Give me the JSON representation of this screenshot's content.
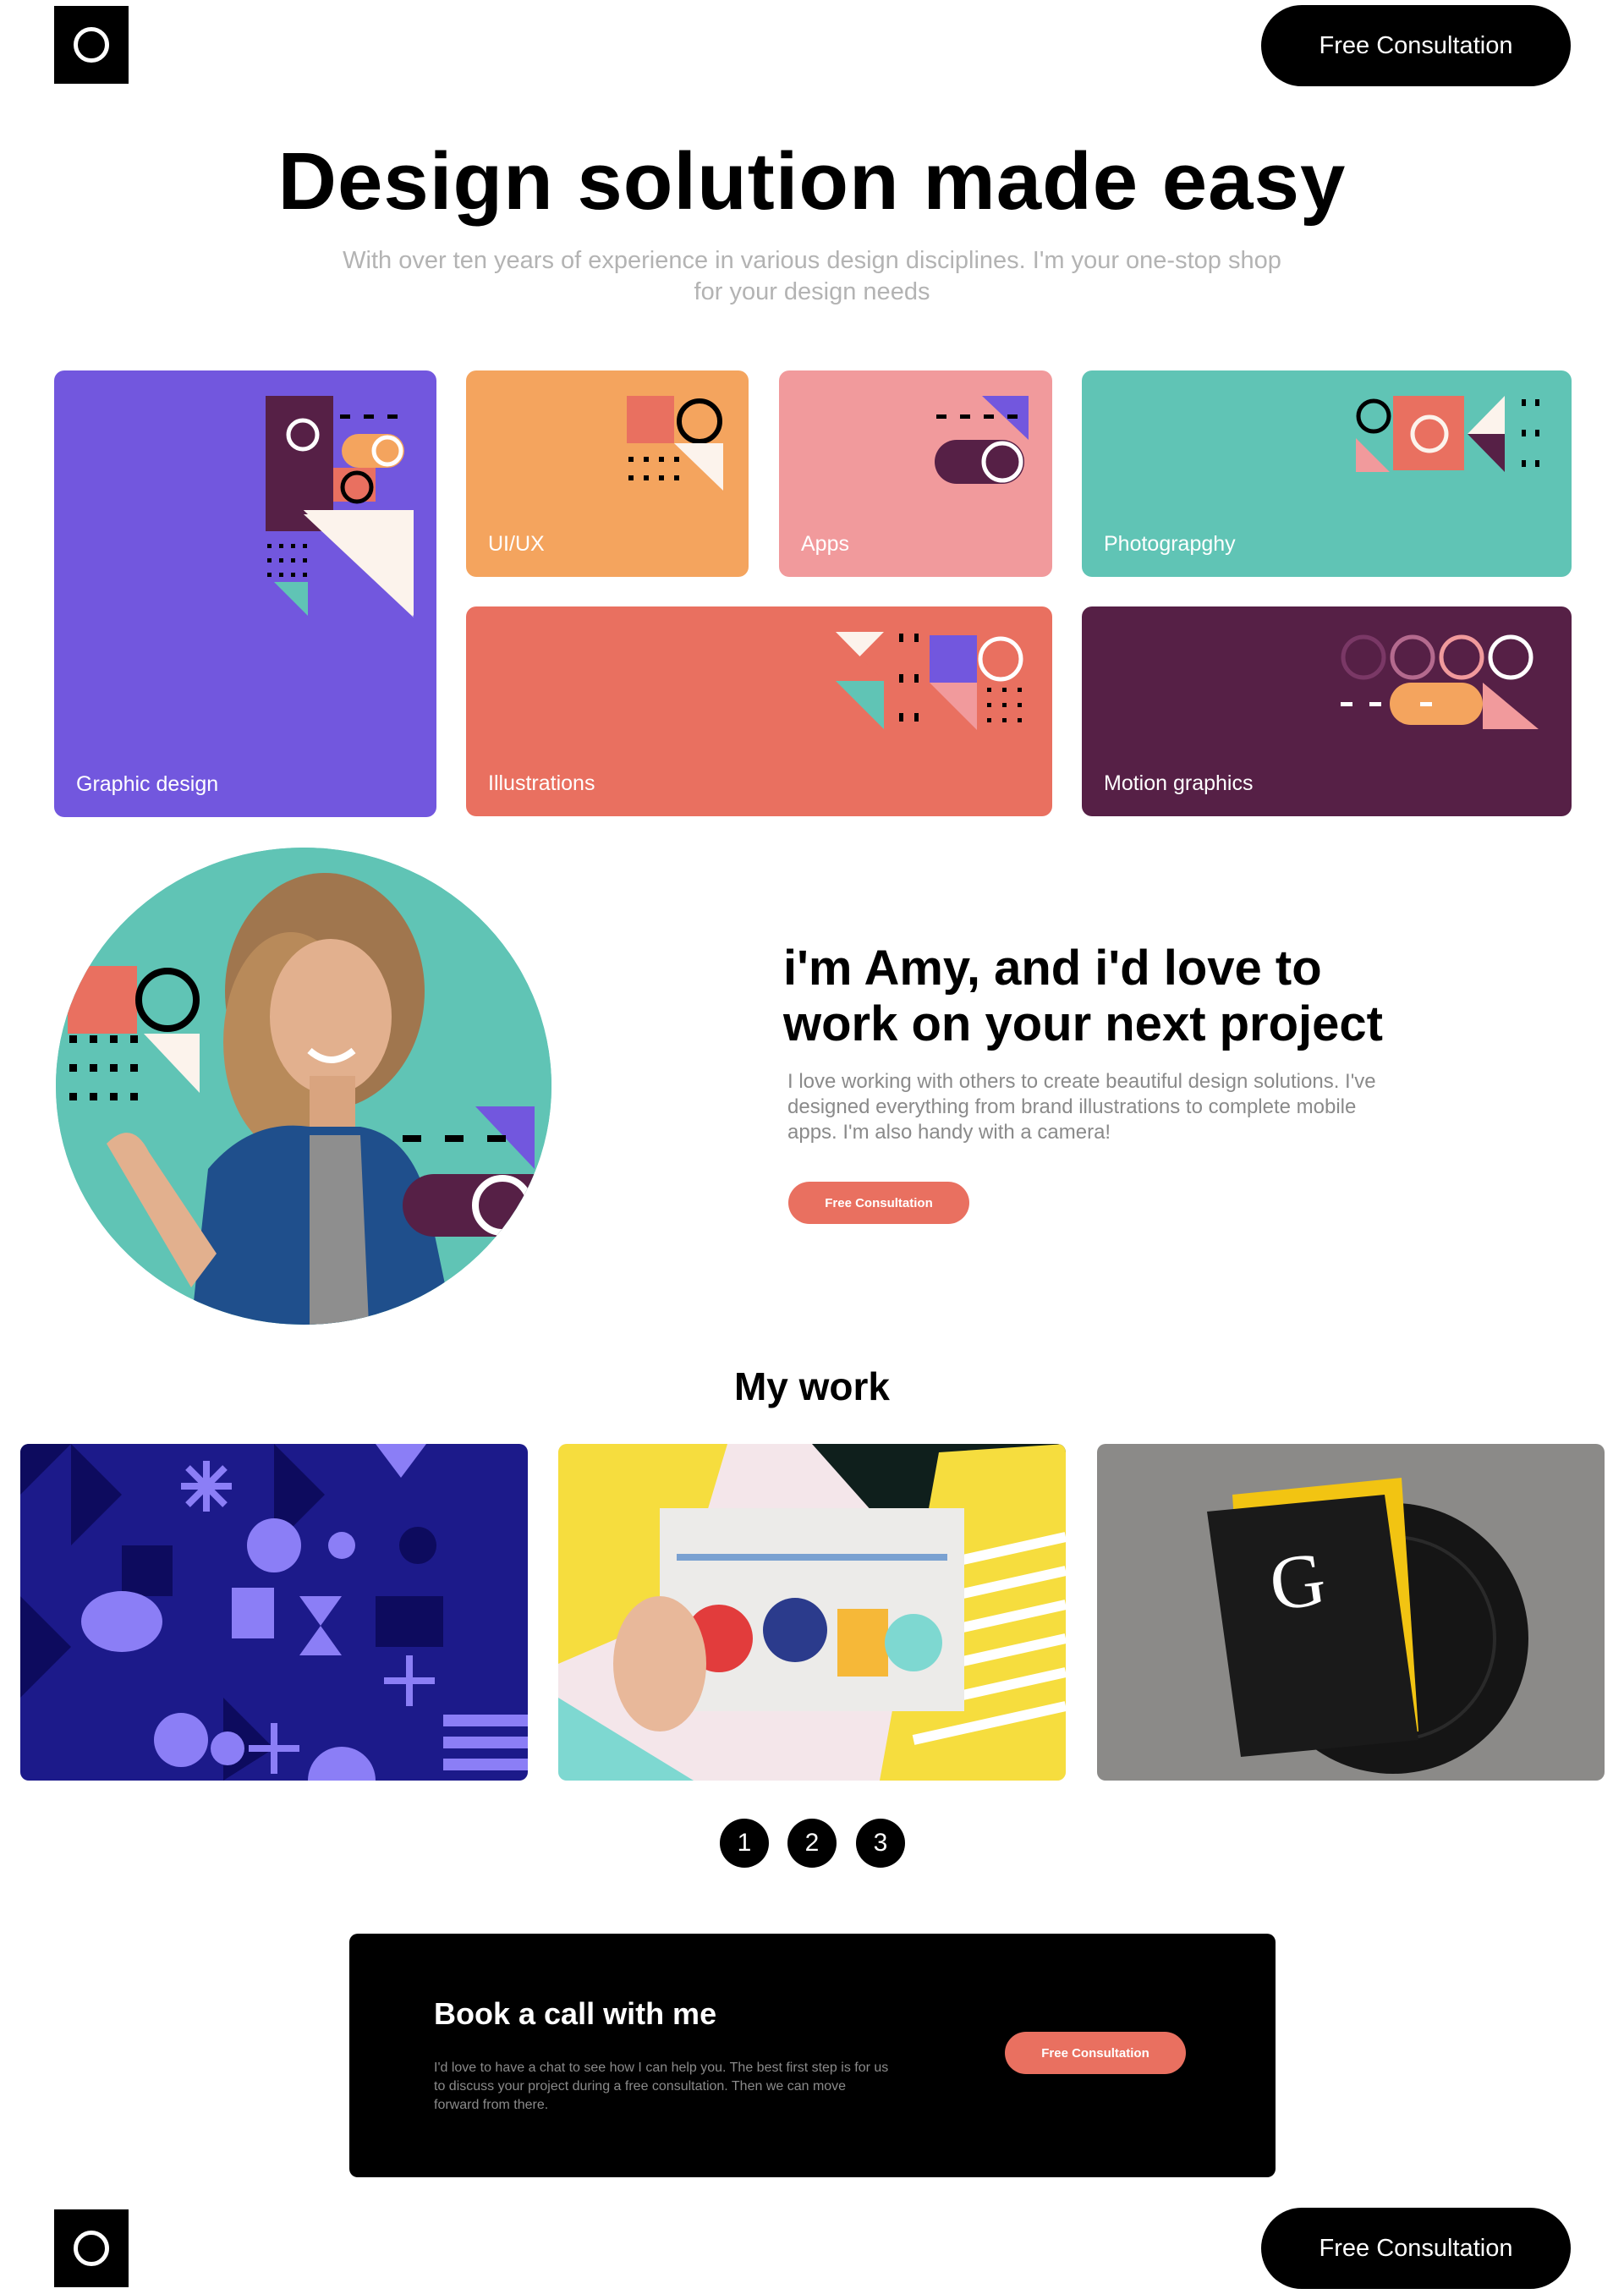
{
  "header": {
    "cta_label": "Free Consultation",
    "logo_icon": "circle-logo-icon"
  },
  "hero": {
    "title": "Design solution made easy",
    "subtitle": "With over ten years of experience in various design disciplines. I'm your one-stop shop for your design needs"
  },
  "services": [
    {
      "label": "Graphic design",
      "color": "#7257de"
    },
    {
      "label": "UI/UX",
      "color": "#f4a45e"
    },
    {
      "label": "Apps",
      "color": "#f19a9c"
    },
    {
      "label": "Photograpghy",
      "color": "#60c4b5"
    },
    {
      "label": "Illustrations",
      "color": "#e97060"
    },
    {
      "label": "Motion graphics",
      "color": "#562046"
    }
  ],
  "about": {
    "title": "i'm Amy, and i'd love to work on your next project",
    "text": "I love working with others to create beautiful design solutions. I've designed everything from brand illustrations to complete mobile apps. I'm also handy with a camera!",
    "cta_label": "Free Consultation"
  },
  "work": {
    "title": "My work",
    "items": [
      {
        "image": "geometric-pattern-image"
      },
      {
        "image": "newspaper-collage-image"
      },
      {
        "image": "graphic-design-book-image"
      }
    ],
    "pages": [
      "1",
      "2",
      "3"
    ]
  },
  "book_call": {
    "title": "Book a call with me",
    "text": "I'd love to have a chat to see how I can help you. The best first step is for us to discuss your project during a free consultation. Then we can move forward from there.",
    "cta_label": "Free Consultation"
  },
  "footer": {
    "cta_label": "Free Consultation",
    "logo_icon": "circle-logo-icon"
  },
  "colors": {
    "purple": "#7257de",
    "orange": "#f4a45e",
    "pink": "#f19a9c",
    "teal": "#60c4b5",
    "coral": "#e97060",
    "plum": "#562046",
    "cream": "#fcf3ec"
  }
}
